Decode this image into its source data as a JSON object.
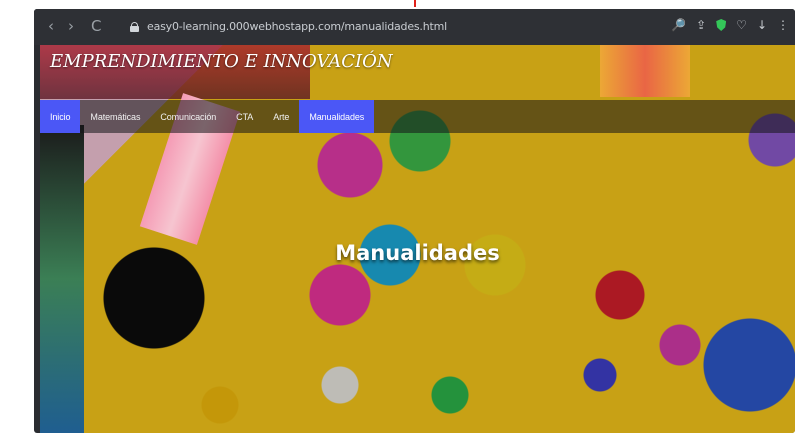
{
  "browser": {
    "url": "easy0-learning.000webhostapp.com/manualidades.html",
    "back_label": "‹",
    "forward_label": "›",
    "reload_label": "C",
    "right_icons": [
      "🔎",
      "⇪",
      "🛡",
      "♡",
      "↓",
      "⋮"
    ]
  },
  "site": {
    "brand": "EMPRENDIMIENTO E INNOVACIÓN",
    "menu": [
      "Inicio",
      "Matemáticas",
      "Comunicación",
      "CTA",
      "Arte",
      "Manualidades"
    ],
    "active_menu_index": 5,
    "hero_title": "Manualidades"
  },
  "colors": {
    "active_menu": "#4b57f6",
    "background": "#f4c51a",
    "frame": "#2a2c31"
  }
}
